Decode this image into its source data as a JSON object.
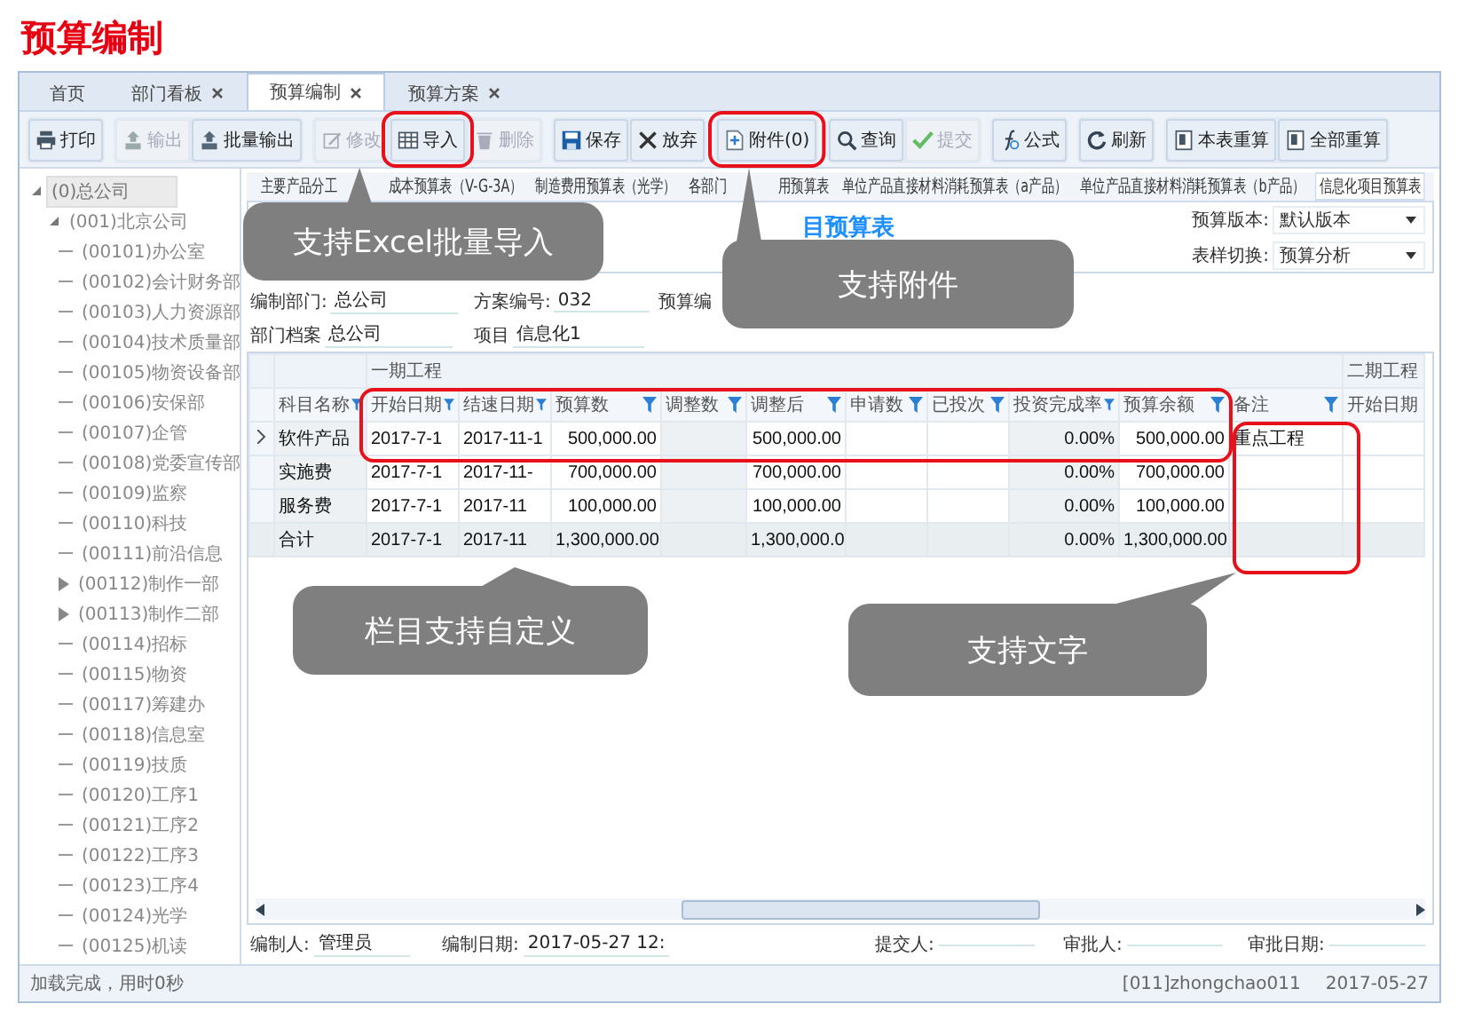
{
  "page_title": "预算编制",
  "tabs": [
    {
      "label": "首页",
      "closable": false,
      "selected": false
    },
    {
      "label": "部门看板",
      "closable": true,
      "selected": false
    },
    {
      "label": "预算编制",
      "closable": true,
      "selected": true
    },
    {
      "label": "预算方案",
      "closable": true,
      "selected": false
    }
  ],
  "toolbar": [
    {
      "items": [
        {
          "label": "打印",
          "disabled": false
        }
      ]
    },
    {
      "items": [
        {
          "label": "输出",
          "disabled": true
        },
        {
          "label": "批量输出",
          "disabled": false
        }
      ]
    },
    {
      "items": [
        {
          "label": "修改",
          "disabled": true
        },
        {
          "label": "导入",
          "disabled": false
        },
        {
          "label": "删除",
          "disabled": true
        }
      ]
    },
    {
      "items": [
        {
          "label": "保存",
          "disabled": false
        },
        {
          "label": "放弃",
          "disabled": false
        }
      ]
    },
    {
      "items": [
        {
          "label": "附件(0)",
          "disabled": false
        }
      ]
    },
    {
      "items": [
        {
          "label": "查询",
          "disabled": false
        },
        {
          "label": "提交",
          "disabled": true
        }
      ]
    },
    {
      "items": [
        {
          "label": "公式",
          "disabled": false
        }
      ]
    },
    {
      "items": [
        {
          "label": "刷新",
          "disabled": false
        }
      ]
    },
    {
      "items": [
        {
          "label": "本表重算",
          "disabled": false
        },
        {
          "label": "全部重算",
          "disabled": false
        }
      ]
    }
  ],
  "tree": [
    {
      "label": "(0)总公司",
      "selected": true,
      "expanded": true,
      "children": [
        {
          "label": "(001)北京公司",
          "selected": false,
          "expanded": true,
          "children": [
            {
              "label": "(00101)办公室",
              "selected": false
            },
            {
              "label": "(00102)会计财务部",
              "selected": false
            },
            {
              "label": "(00103)人力资源部",
              "selected": false
            },
            {
              "label": "(00104)技术质量部",
              "selected": false
            },
            {
              "label": "(00105)物资设备部",
              "selected": false
            },
            {
              "label": "(00106)安保部",
              "selected": false
            },
            {
              "label": "(00107)企管",
              "selected": false
            },
            {
              "label": "(00108)党委宣传部",
              "selected": false
            },
            {
              "label": "(00109)监察",
              "selected": false
            },
            {
              "label": "(00110)科技",
              "selected": false
            },
            {
              "label": "(00111)前沿信息",
              "selected": false
            },
            {
              "label": "(00112)制作一部",
              "selected": false,
              "expanded": false
            },
            {
              "label": "(00113)制作二部",
              "selected": false,
              "expanded": false
            },
            {
              "label": "(00114)招标",
              "selected": false
            },
            {
              "label": "(00115)物资",
              "selected": false
            },
            {
              "label": "(00117)筹建办",
              "selected": false
            },
            {
              "label": "(00118)信息室",
              "selected": false
            },
            {
              "label": "(00119)技质",
              "selected": false
            },
            {
              "label": "(00120)工序1",
              "selected": false
            },
            {
              "label": "(00121)工序2",
              "selected": false
            },
            {
              "label": "(00122)工序3",
              "selected": false
            },
            {
              "label": "(00123)工序4",
              "selected": false
            },
            {
              "label": "(00124)光学",
              "selected": false
            },
            {
              "label": "(00125)机读",
              "selected": false
            }
          ]
        }
      ]
    }
  ],
  "sheet_tabs": [
    {
      "label": "主要产品分工",
      "selected": false
    },
    {
      "label": "成本预算表（V-G-3A）",
      "selected": false
    },
    {
      "label": "制造费用预算表（光学）",
      "selected": false
    },
    {
      "label": "各部门",
      "selected": false
    },
    {
      "label": "用预算表",
      "selected": false
    },
    {
      "label": "单位产品直接材料消耗预算表（a产品）",
      "selected": false
    },
    {
      "label": "单位产品直接材料消耗预算表（b产品）",
      "selected": false
    },
    {
      "label": "信息化项目预算表",
      "selected": true
    }
  ],
  "report": {
    "title": "目预算表",
    "options": [
      {
        "label": "预算版本:",
        "value": "默认版本"
      },
      {
        "label": "表样切换:",
        "value": "预算分析"
      }
    ]
  },
  "form": [
    [
      {
        "label": "编制部门:",
        "value": "总公司"
      },
      {
        "label": "方案编号:",
        "value": "032"
      },
      {
        "label": "预算编"
      }
    ],
    [
      {
        "label": "部门档案",
        "value": "总公司"
      },
      {
        "label": "项目",
        "value": "信息化1"
      }
    ]
  ],
  "table": {
    "groups": [
      {
        "label": "一期工程"
      },
      {
        "label": "二期工程"
      }
    ],
    "columns": [
      {
        "label": "科目名称",
        "filter": true,
        "shaded": true
      },
      {
        "label": "开始日期",
        "filter": true,
        "shaded": false
      },
      {
        "label": "结速日期",
        "filter": true,
        "shaded": false
      },
      {
        "label": "预算数",
        "filter": true,
        "shaded": false
      },
      {
        "label": "调整数",
        "filter": true,
        "shaded": true
      },
      {
        "label": "调整后",
        "filter": true,
        "shaded": false
      },
      {
        "label": "申请数",
        "filter": true,
        "shaded": false
      },
      {
        "label": "已投次",
        "filter": true,
        "shaded": false
      },
      {
        "label": "投资完成率",
        "filter": true,
        "shaded": true
      },
      {
        "label": "预算余额",
        "filter": true,
        "shaded": false
      },
      {
        "label": "备注",
        "filter": true,
        "shaded": false
      },
      {
        "label": "开始日期",
        "filter": false,
        "shaded": false
      }
    ],
    "rows": [
      {
        "kind": "item",
        "current": true,
        "cells": [
          "软件产品",
          "2017-7-1",
          "2017-11-1",
          "500,000.00",
          "",
          "500,000.00",
          "",
          "",
          "0.00%",
          "500,000.00",
          "重点工程",
          ""
        ]
      },
      {
        "kind": "item",
        "current": false,
        "cells": [
          "实施费",
          "2017-7-1",
          "2017-11-",
          "700,000.00",
          "",
          "700,000.00",
          "",
          "",
          "0.00%",
          "700,000.00",
          "",
          ""
        ]
      },
      {
        "kind": "item",
        "current": false,
        "cells": [
          "服务费",
          "2017-7-1",
          "2017-11",
          "100,000.00",
          "",
          "100,000.00",
          "",
          "",
          "0.00%",
          "100,000.00",
          "",
          ""
        ]
      },
      {
        "kind": "total",
        "current": false,
        "cells": [
          "合计",
          "2017-7-1",
          "2017-11",
          "1,300,000.00",
          "",
          "1,300,000.0",
          "",
          "",
          "0.00%",
          "1,300,000.00",
          "",
          ""
        ]
      }
    ]
  },
  "footer": [
    {
      "label": "编制人:",
      "value": "管理员"
    },
    {
      "label": "编制日期:",
      "value": "2017-05-27 12:"
    },
    {
      "label": "提交人:"
    },
    {
      "label": "审批人:"
    },
    {
      "label": "审批日期:"
    }
  ],
  "status": {
    "message": "加载完成，用时0秒",
    "user": "[011]zhongchao011",
    "date": "2017-05-27"
  },
  "callouts": [
    {
      "text": "支持Excel批量导入"
    },
    {
      "text": "支持附件"
    },
    {
      "text": "栏目支持自定义"
    },
    {
      "text": "支持文字"
    }
  ]
}
